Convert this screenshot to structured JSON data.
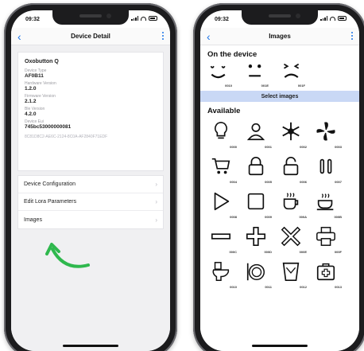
{
  "left": {
    "status_time": "09:32",
    "nav_title": "Device Detail",
    "device_name": "Oxobutton Q",
    "fields": [
      {
        "label": "Device Type",
        "value": "AF0B11"
      },
      {
        "label": "Hardware Version",
        "value": "1.2.0"
      },
      {
        "label": "Firmware Version",
        "value": "2.1.2"
      },
      {
        "label": "Ble Version",
        "value": "4.2.0"
      },
      {
        "label": "Device Eui",
        "value": "745bc53000000081"
      }
    ],
    "uuid": "8C81D8C2-AE6C-2124-8C0A-AF2840F71EDF",
    "menu": [
      "Device Configuration",
      "Edit Lora Parameters",
      "Images"
    ],
    "accent": "#1a73e8",
    "arrow_color": "#2fb84e"
  },
  "right": {
    "status_time": "09:32",
    "nav_title": "Images",
    "on_device_title": "On the device",
    "on_device": [
      {
        "code": "0010",
        "icon": "face-sad-icon"
      },
      {
        "code": "001E",
        "icon": "face-neutral-icon"
      },
      {
        "code": "001F",
        "icon": "face-squint-icon"
      }
    ],
    "select_label": "Select images",
    "available_title": "Available",
    "available": [
      {
        "code": "0000",
        "icon": "lightbulb-icon"
      },
      {
        "code": "0001",
        "icon": "person-icon"
      },
      {
        "code": "0002",
        "icon": "snowflake-icon"
      },
      {
        "code": "0003",
        "icon": "fan-icon"
      },
      {
        "code": "0004",
        "icon": "shopping-cart-icon"
      },
      {
        "code": "0005",
        "icon": "lock-closed-icon"
      },
      {
        "code": "0006",
        "icon": "lock-open-icon"
      },
      {
        "code": "0007",
        "icon": "pause-icon"
      },
      {
        "code": "0008",
        "icon": "play-icon"
      },
      {
        "code": "0009",
        "icon": "stop-icon"
      },
      {
        "code": "000A",
        "icon": "coffee-cup-icon"
      },
      {
        "code": "000B",
        "icon": "tea-cup-icon"
      },
      {
        "code": "000C",
        "icon": "minus-icon"
      },
      {
        "code": "000D",
        "icon": "plus-icon"
      },
      {
        "code": "000E",
        "icon": "close-x-icon"
      },
      {
        "code": "000F",
        "icon": "printer-icon"
      },
      {
        "code": "0010",
        "icon": "toilet-icon"
      },
      {
        "code": "0011",
        "icon": "plate-cutlery-icon"
      },
      {
        "code": "0012",
        "icon": "trash-bin-icon"
      },
      {
        "code": "0013",
        "icon": "first-aid-icon"
      }
    ],
    "accent": "#1a73e8",
    "select_bar_color": "#c9d8f5"
  }
}
